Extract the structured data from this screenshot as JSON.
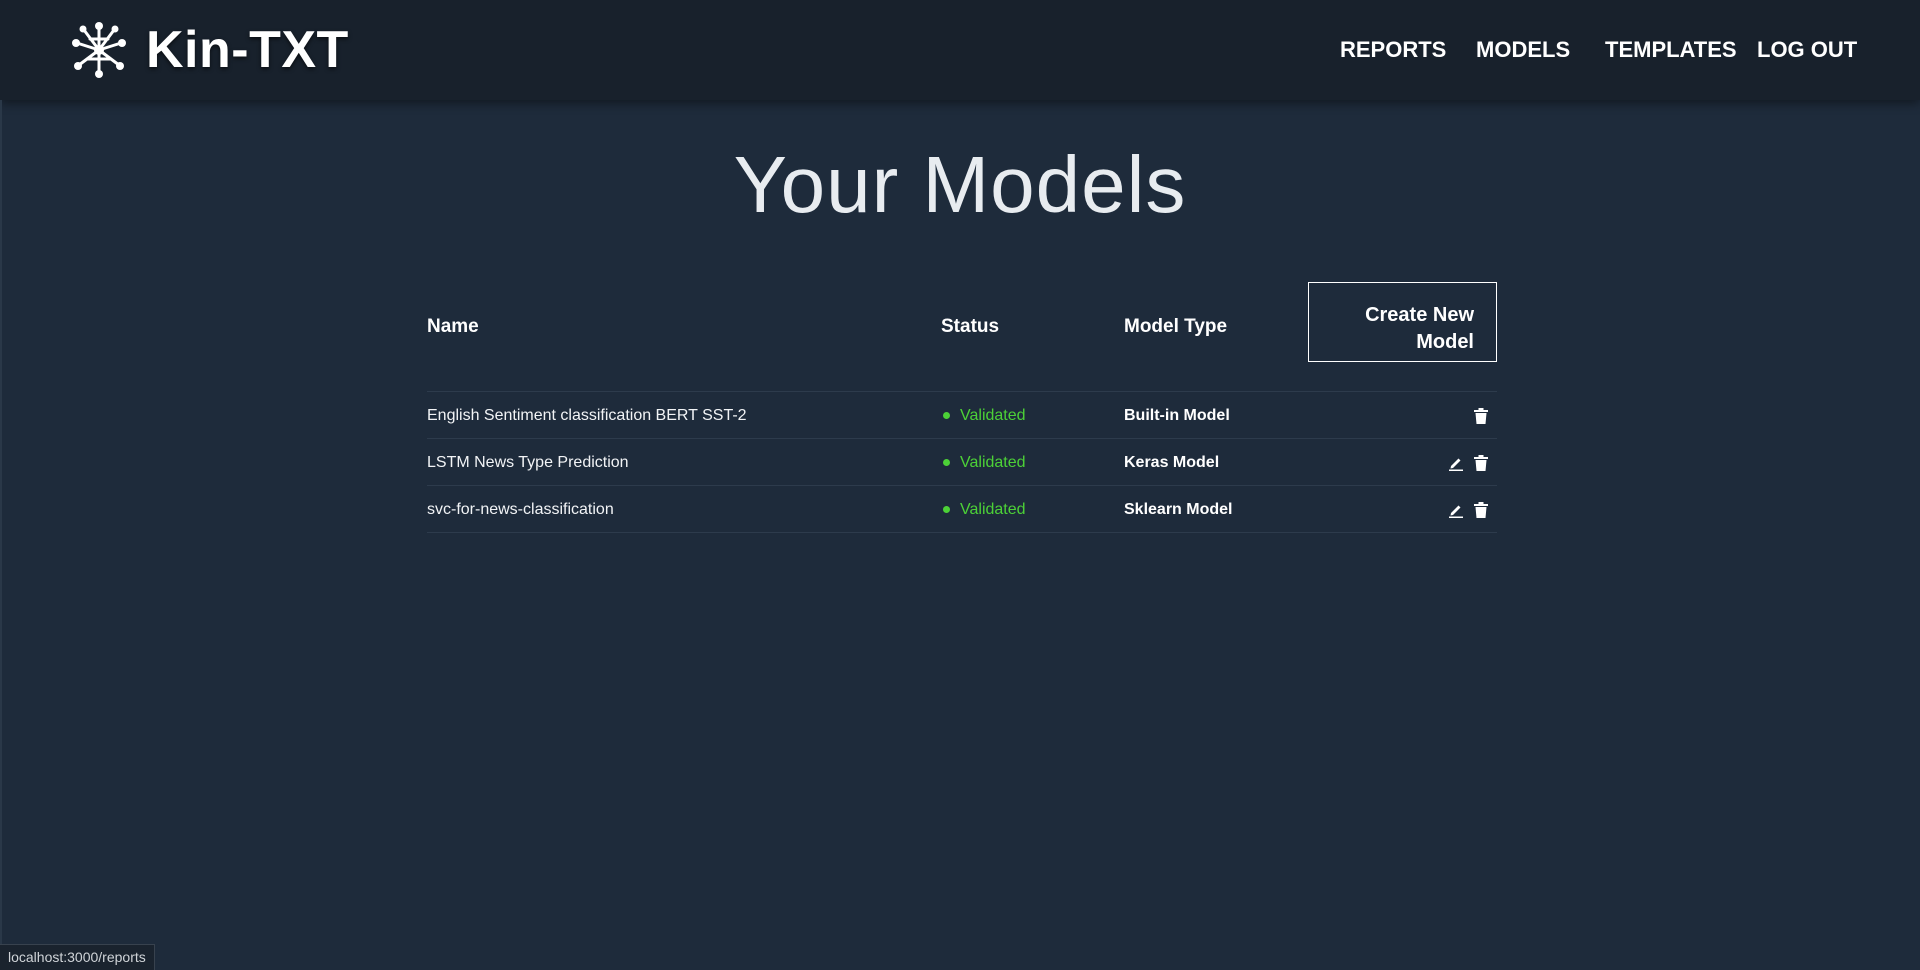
{
  "navbar": {
    "brand_name": "Kin-TXT",
    "links": [
      {
        "label": "REPORTS"
      },
      {
        "label": "MODELS"
      },
      {
        "label": "TEMPLATES"
      },
      {
        "label": "LOG OUT"
      }
    ]
  },
  "page": {
    "title": "Your Models"
  },
  "table": {
    "headers": {
      "name": "Name",
      "status": "Status",
      "model_type": "Model Type"
    },
    "create_button_label": "Create New Model",
    "rows": [
      {
        "name": "English Sentiment classification BERT SST-2",
        "status": "Validated",
        "model_type": "Built-in Model",
        "editable": false
      },
      {
        "name": "LSTM News Type Prediction",
        "status": "Validated",
        "model_type": "Keras Model",
        "editable": true
      },
      {
        "name": "svc-for-news-classification",
        "status": "Validated",
        "model_type": "Sklearn Model",
        "editable": true
      }
    ]
  },
  "status_bar": {
    "url": "localhost:3000/reports"
  },
  "colors": {
    "background": "#1e2b3b",
    "navbar": "#18212c",
    "status_validated": "#4cd137"
  },
  "icons": {
    "logo": "network-nodes-icon",
    "edit": "pencil-icon",
    "delete": "trash-icon"
  }
}
